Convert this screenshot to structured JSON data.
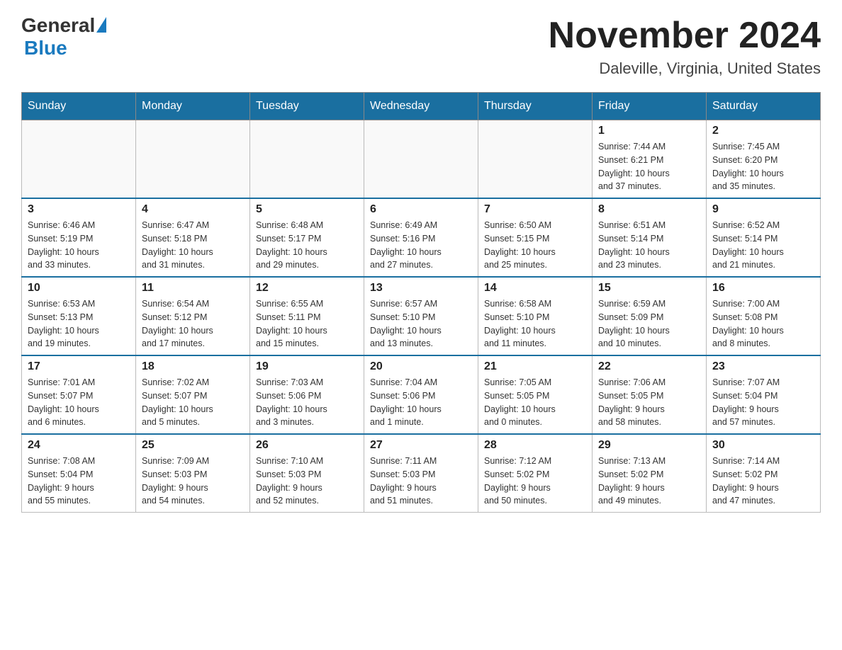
{
  "header": {
    "logo_general": "General",
    "logo_blue": "Blue",
    "title": "November 2024",
    "subtitle": "Daleville, Virginia, United States"
  },
  "days_of_week": [
    "Sunday",
    "Monday",
    "Tuesday",
    "Wednesday",
    "Thursday",
    "Friday",
    "Saturday"
  ],
  "weeks": [
    [
      {
        "day": "",
        "info": ""
      },
      {
        "day": "",
        "info": ""
      },
      {
        "day": "",
        "info": ""
      },
      {
        "day": "",
        "info": ""
      },
      {
        "day": "",
        "info": ""
      },
      {
        "day": "1",
        "info": "Sunrise: 7:44 AM\nSunset: 6:21 PM\nDaylight: 10 hours\nand 37 minutes."
      },
      {
        "day": "2",
        "info": "Sunrise: 7:45 AM\nSunset: 6:20 PM\nDaylight: 10 hours\nand 35 minutes."
      }
    ],
    [
      {
        "day": "3",
        "info": "Sunrise: 6:46 AM\nSunset: 5:19 PM\nDaylight: 10 hours\nand 33 minutes."
      },
      {
        "day": "4",
        "info": "Sunrise: 6:47 AM\nSunset: 5:18 PM\nDaylight: 10 hours\nand 31 minutes."
      },
      {
        "day": "5",
        "info": "Sunrise: 6:48 AM\nSunset: 5:17 PM\nDaylight: 10 hours\nand 29 minutes."
      },
      {
        "day": "6",
        "info": "Sunrise: 6:49 AM\nSunset: 5:16 PM\nDaylight: 10 hours\nand 27 minutes."
      },
      {
        "day": "7",
        "info": "Sunrise: 6:50 AM\nSunset: 5:15 PM\nDaylight: 10 hours\nand 25 minutes."
      },
      {
        "day": "8",
        "info": "Sunrise: 6:51 AM\nSunset: 5:14 PM\nDaylight: 10 hours\nand 23 minutes."
      },
      {
        "day": "9",
        "info": "Sunrise: 6:52 AM\nSunset: 5:14 PM\nDaylight: 10 hours\nand 21 minutes."
      }
    ],
    [
      {
        "day": "10",
        "info": "Sunrise: 6:53 AM\nSunset: 5:13 PM\nDaylight: 10 hours\nand 19 minutes."
      },
      {
        "day": "11",
        "info": "Sunrise: 6:54 AM\nSunset: 5:12 PM\nDaylight: 10 hours\nand 17 minutes."
      },
      {
        "day": "12",
        "info": "Sunrise: 6:55 AM\nSunset: 5:11 PM\nDaylight: 10 hours\nand 15 minutes."
      },
      {
        "day": "13",
        "info": "Sunrise: 6:57 AM\nSunset: 5:10 PM\nDaylight: 10 hours\nand 13 minutes."
      },
      {
        "day": "14",
        "info": "Sunrise: 6:58 AM\nSunset: 5:10 PM\nDaylight: 10 hours\nand 11 minutes."
      },
      {
        "day": "15",
        "info": "Sunrise: 6:59 AM\nSunset: 5:09 PM\nDaylight: 10 hours\nand 10 minutes."
      },
      {
        "day": "16",
        "info": "Sunrise: 7:00 AM\nSunset: 5:08 PM\nDaylight: 10 hours\nand 8 minutes."
      }
    ],
    [
      {
        "day": "17",
        "info": "Sunrise: 7:01 AM\nSunset: 5:07 PM\nDaylight: 10 hours\nand 6 minutes."
      },
      {
        "day": "18",
        "info": "Sunrise: 7:02 AM\nSunset: 5:07 PM\nDaylight: 10 hours\nand 5 minutes."
      },
      {
        "day": "19",
        "info": "Sunrise: 7:03 AM\nSunset: 5:06 PM\nDaylight: 10 hours\nand 3 minutes."
      },
      {
        "day": "20",
        "info": "Sunrise: 7:04 AM\nSunset: 5:06 PM\nDaylight: 10 hours\nand 1 minute."
      },
      {
        "day": "21",
        "info": "Sunrise: 7:05 AM\nSunset: 5:05 PM\nDaylight: 10 hours\nand 0 minutes."
      },
      {
        "day": "22",
        "info": "Sunrise: 7:06 AM\nSunset: 5:05 PM\nDaylight: 9 hours\nand 58 minutes."
      },
      {
        "day": "23",
        "info": "Sunrise: 7:07 AM\nSunset: 5:04 PM\nDaylight: 9 hours\nand 57 minutes."
      }
    ],
    [
      {
        "day": "24",
        "info": "Sunrise: 7:08 AM\nSunset: 5:04 PM\nDaylight: 9 hours\nand 55 minutes."
      },
      {
        "day": "25",
        "info": "Sunrise: 7:09 AM\nSunset: 5:03 PM\nDaylight: 9 hours\nand 54 minutes."
      },
      {
        "day": "26",
        "info": "Sunrise: 7:10 AM\nSunset: 5:03 PM\nDaylight: 9 hours\nand 52 minutes."
      },
      {
        "day": "27",
        "info": "Sunrise: 7:11 AM\nSunset: 5:03 PM\nDaylight: 9 hours\nand 51 minutes."
      },
      {
        "day": "28",
        "info": "Sunrise: 7:12 AM\nSunset: 5:02 PM\nDaylight: 9 hours\nand 50 minutes."
      },
      {
        "day": "29",
        "info": "Sunrise: 7:13 AM\nSunset: 5:02 PM\nDaylight: 9 hours\nand 49 minutes."
      },
      {
        "day": "30",
        "info": "Sunrise: 7:14 AM\nSunset: 5:02 PM\nDaylight: 9 hours\nand 47 minutes."
      }
    ]
  ]
}
